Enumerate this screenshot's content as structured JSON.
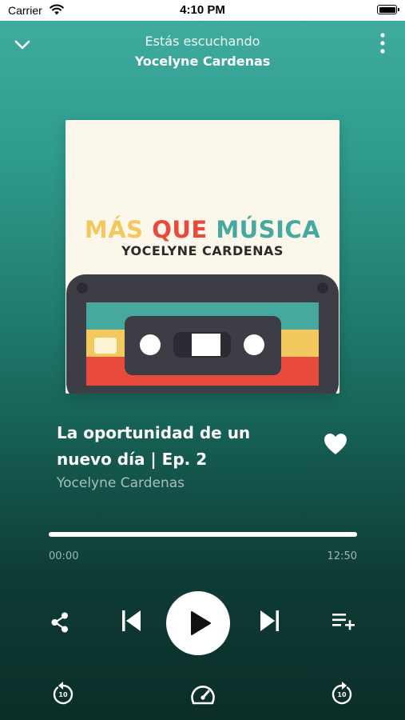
{
  "status_bar": {
    "carrier": "Carrier",
    "time": "4:10 PM"
  },
  "header": {
    "caption": "Estás escuchando",
    "title": "Yocelyne Cardenas"
  },
  "artwork": {
    "title_words": [
      "MÁS",
      "QUE",
      "MÚSICA"
    ],
    "title_colors": [
      "#f3c85e",
      "#e84a3c",
      "#45a9a0"
    ],
    "subtitle": "YOCELYNE CARDENAS"
  },
  "episode": {
    "title": "La oportunidad de un nuevo día | Ep. 2",
    "author": "Yocelyne Cardenas",
    "favorite_icon": "heart-icon"
  },
  "player": {
    "progress_fraction": 1.0,
    "elapsed": "00:00",
    "duration": "12:50",
    "rewind_seconds": "10",
    "forward_seconds": "10"
  },
  "colors": {
    "gradient_top": "#42aea2",
    "gradient_bottom": "#0b2d28",
    "accent_red": "#e84a3c",
    "accent_yellow": "#f3c85e",
    "accent_teal": "#45a9a0"
  }
}
